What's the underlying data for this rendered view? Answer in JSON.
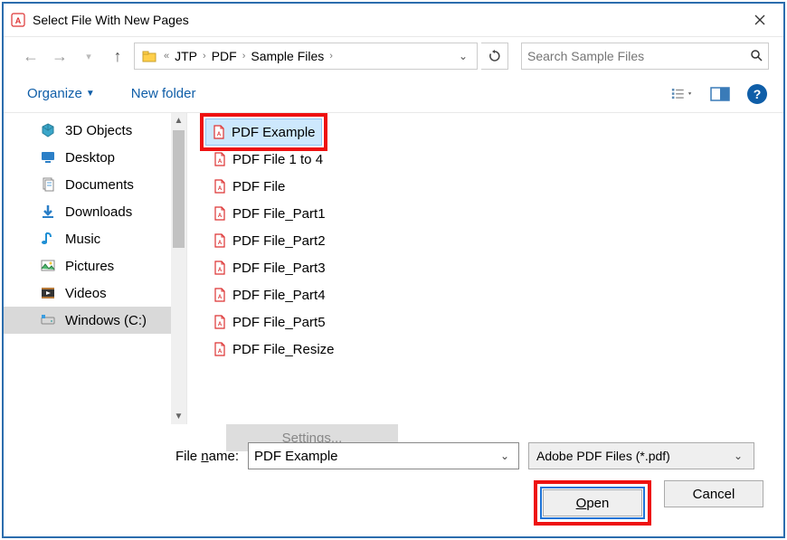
{
  "window": {
    "title": "Select File With New Pages"
  },
  "nav": {
    "path": [
      "JTP",
      "PDF",
      "Sample Files"
    ],
    "search_placeholder": "Search Sample Files"
  },
  "toolbar": {
    "organize_label": "Organize",
    "newfolder_label": "New folder"
  },
  "sidebar": {
    "items": [
      {
        "label": "3D Objects",
        "icon": "3d"
      },
      {
        "label": "Desktop",
        "icon": "desktop"
      },
      {
        "label": "Documents",
        "icon": "documents"
      },
      {
        "label": "Downloads",
        "icon": "downloads"
      },
      {
        "label": "Music",
        "icon": "music"
      },
      {
        "label": "Pictures",
        "icon": "pictures"
      },
      {
        "label": "Videos",
        "icon": "videos"
      },
      {
        "label": "Windows (C:)",
        "icon": "drive"
      }
    ],
    "selected_index": 7
  },
  "files": {
    "items": [
      "PDF Example",
      "PDF File 1 to 4",
      "PDF File",
      "PDF File_Part1",
      "PDF File_Part2",
      "PDF File_Part3",
      "PDF File_Part4",
      "PDF File_Part5",
      "PDF File_Resize"
    ],
    "selected_index": 0
  },
  "settings": {
    "label": "Settings..."
  },
  "footer": {
    "filename_label": "File name:",
    "filename_value": "PDF Example",
    "filter_label": "Adobe PDF Files (*.pdf)",
    "open_label": "Open",
    "cancel_label": "Cancel"
  }
}
